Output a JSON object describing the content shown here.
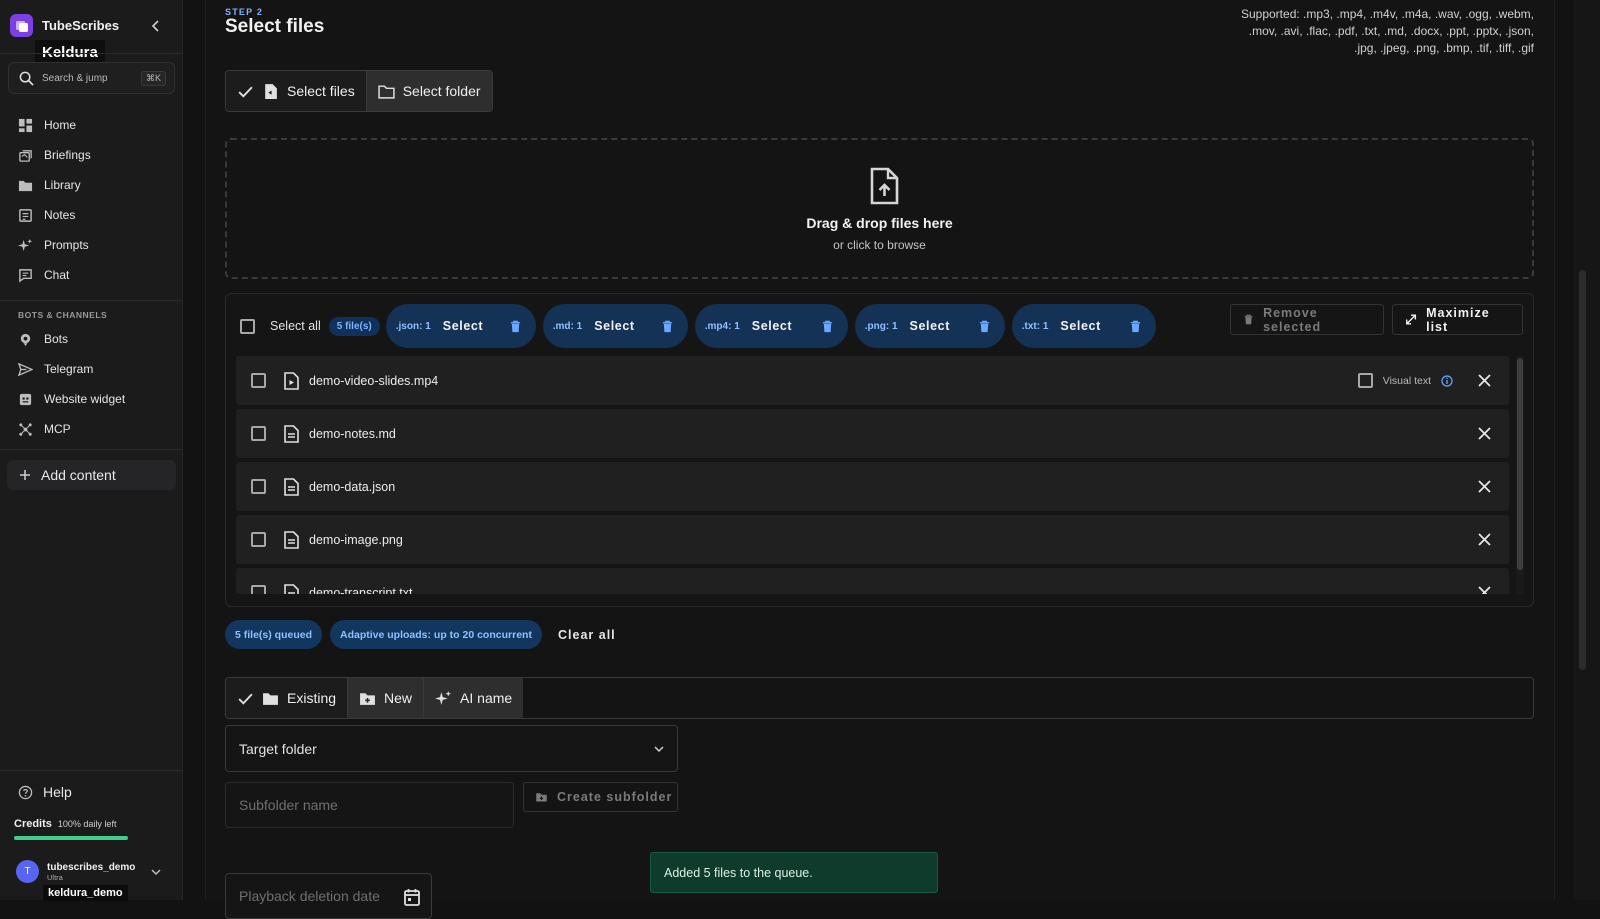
{
  "app": {
    "name": "TubeScribes",
    "workspace_tooltip": "Keldura",
    "search_placeholder": "Search & jump",
    "search_shortcut": "⌘K"
  },
  "sidebar": {
    "items": [
      {
        "label": "Home",
        "icon": "grid-icon"
      },
      {
        "label": "Briefings",
        "icon": "briefings-icon"
      },
      {
        "label": "Library",
        "icon": "folder-icon"
      },
      {
        "label": "Notes",
        "icon": "notes-icon"
      },
      {
        "label": "Prompts",
        "icon": "sparkle-icon"
      },
      {
        "label": "Chat",
        "icon": "chat-icon"
      }
    ],
    "section_label": "BOTS & CHANNELS",
    "channel_items": [
      {
        "label": "Bots",
        "icon": "bot-icon"
      },
      {
        "label": "Telegram",
        "icon": "send-icon"
      },
      {
        "label": "Website widget",
        "icon": "widget-icon"
      },
      {
        "label": "MCP",
        "icon": "mcp-icon"
      }
    ],
    "add_content": "Add content",
    "help": "Help",
    "credits_label": "Credits",
    "credits_status": "100% daily left",
    "credits_fraction": 1.0,
    "user": {
      "initial": "T",
      "name": "tubescribes_demo",
      "plan": "Ultra",
      "tooltip": "keldura_demo"
    }
  },
  "main": {
    "step_label": "STEP 2",
    "title": "Select files",
    "supported_line1": "Supported: .mp3, .mp4, .m4v, .m4a, .wav, .ogg, .webm,",
    "supported_line2": ".mov, .avi, .flac, .pdf, .txt, .md, .docx, .ppt, .pptx, .json,",
    "supported_line3": ".jpg, .jpeg, .png, .bmp, .tif, .tiff, .gif",
    "mode_select_files": "Select files",
    "mode_select_folder": "Select folder",
    "dropzone_title": "Drag & drop files here",
    "dropzone_sub": "or click to browse",
    "select_all": "Select all",
    "file_count": "5 file(s)",
    "ext_chips": [
      {
        "label": ".json: 1",
        "action": "Select"
      },
      {
        "label": ".md: 1",
        "action": "Select"
      },
      {
        "label": ".mp4: 1",
        "action": "Select"
      },
      {
        "label": ".png: 1",
        "action": "Select"
      },
      {
        "label": ".txt: 1",
        "action": "Select"
      }
    ],
    "remove_selected": "Remove selected",
    "maximize_list": "Maximize list",
    "visual_text": "Visual text",
    "files": [
      "demo-video-slides.mp4",
      "demo-notes.md",
      "demo-data.json",
      "demo-image.png",
      "demo-transcript.txt"
    ],
    "queued": "5 file(s) queued",
    "adaptive": "Adaptive uploads: up to 20 concurrent",
    "clear_all": "Clear all",
    "folder_existing": "Existing",
    "folder_new": "New",
    "folder_ai": "AI name",
    "target_folder": "Target folder",
    "subfolder_placeholder": "Subfolder name",
    "create_subfolder": "Create subfolder",
    "playback_placeholder": "Playback deletion date",
    "toast": "Added 5 files to the queue."
  }
}
